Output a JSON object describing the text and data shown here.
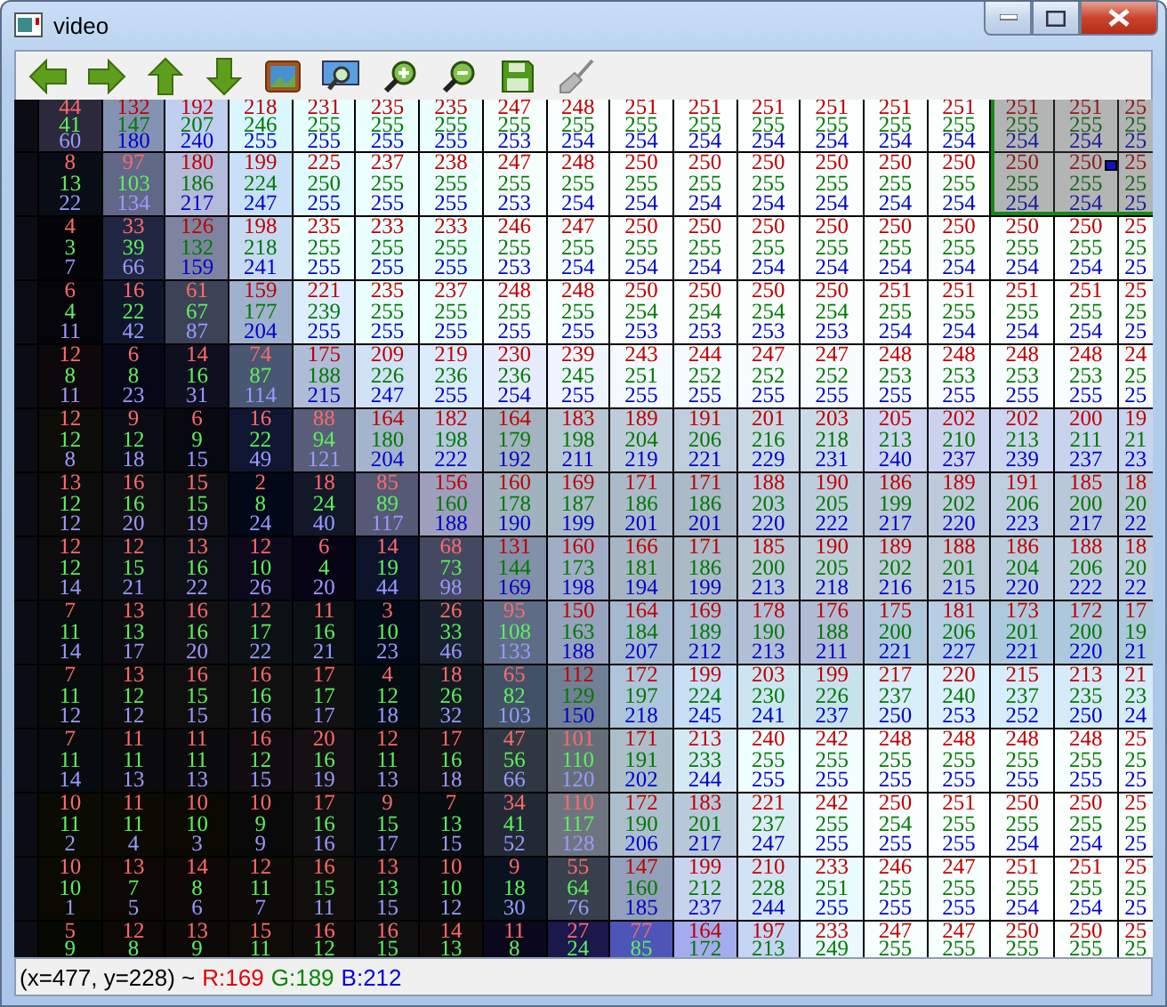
{
  "window": {
    "title": "video"
  },
  "selection": {
    "shown": true
  },
  "pixel_grid": {
    "rows": [
      {
        "red": [
          "44",
          "132",
          "192",
          "218",
          "231",
          "235",
          "235",
          "247",
          "248",
          "251",
          "251",
          "251",
          "251",
          "251",
          "251",
          "251",
          "251",
          "25"
        ],
        "green": [
          "41",
          "147",
          "207",
          "246",
          "255",
          "255",
          "255",
          "255",
          "255",
          "255",
          "255",
          "255",
          "255",
          "255",
          "255",
          "255",
          "255",
          "25"
        ],
        "blue": [
          "60",
          "180",
          "240",
          "255",
          "255",
          "255",
          "255",
          "253",
          "254",
          "254",
          "254",
          "254",
          "254",
          "254",
          "254",
          "254",
          "254",
          "25"
        ]
      },
      {
        "red": [
          "8",
          "97",
          "180",
          "199",
          "225",
          "237",
          "238",
          "247",
          "248",
          "250",
          "250",
          "250",
          "250",
          "250",
          "250",
          "250",
          "250",
          "25"
        ],
        "green": [
          "13",
          "103",
          "186",
          "224",
          "250",
          "255",
          "255",
          "255",
          "255",
          "255",
          "255",
          "255",
          "255",
          "255",
          "255",
          "255",
          "255",
          "25"
        ],
        "blue": [
          "22",
          "134",
          "217",
          "247",
          "255",
          "255",
          "255",
          "253",
          "254",
          "254",
          "254",
          "254",
          "254",
          "254",
          "254",
          "254",
          "254",
          "25"
        ]
      },
      {
        "red": [
          "4",
          "33",
          "126",
          "198",
          "235",
          "233",
          "233",
          "246",
          "247",
          "250",
          "250",
          "250",
          "250",
          "250",
          "250",
          "250",
          "250",
          "25"
        ],
        "green": [
          "3",
          "39",
          "132",
          "218",
          "255",
          "255",
          "255",
          "255",
          "255",
          "255",
          "255",
          "255",
          "255",
          "255",
          "255",
          "255",
          "255",
          "25"
        ],
        "blue": [
          "7",
          "66",
          "159",
          "241",
          "255",
          "255",
          "255",
          "253",
          "254",
          "254",
          "254",
          "254",
          "254",
          "254",
          "254",
          "254",
          "254",
          "25"
        ]
      },
      {
        "red": [
          "6",
          "16",
          "61",
          "159",
          "221",
          "235",
          "237",
          "248",
          "248",
          "250",
          "250",
          "250",
          "250",
          "251",
          "251",
          "251",
          "251",
          "25"
        ],
        "green": [
          "4",
          "22",
          "67",
          "177",
          "239",
          "255",
          "255",
          "255",
          "255",
          "254",
          "254",
          "254",
          "254",
          "255",
          "255",
          "255",
          "255",
          "25"
        ],
        "blue": [
          "11",
          "42",
          "87",
          "204",
          "255",
          "255",
          "255",
          "255",
          "255",
          "253",
          "253",
          "253",
          "253",
          "254",
          "254",
          "254",
          "254",
          "25"
        ]
      },
      {
        "red": [
          "12",
          "6",
          "14",
          "74",
          "175",
          "209",
          "219",
          "230",
          "239",
          "243",
          "244",
          "247",
          "247",
          "248",
          "248",
          "248",
          "248",
          "24"
        ],
        "green": [
          "8",
          "8",
          "16",
          "87",
          "188",
          "226",
          "236",
          "236",
          "245",
          "251",
          "252",
          "252",
          "252",
          "253",
          "253",
          "253",
          "253",
          "25"
        ],
        "blue": [
          "11",
          "23",
          "31",
          "114",
          "215",
          "247",
          "255",
          "254",
          "255",
          "255",
          "255",
          "255",
          "255",
          "255",
          "255",
          "255",
          "255",
          "25"
        ]
      },
      {
        "red": [
          "12",
          "9",
          "6",
          "16",
          "88",
          "164",
          "182",
          "164",
          "183",
          "189",
          "191",
          "201",
          "203",
          "205",
          "202",
          "202",
          "200",
          "19"
        ],
        "green": [
          "12",
          "12",
          "9",
          "22",
          "94",
          "180",
          "198",
          "179",
          "198",
          "204",
          "206",
          "216",
          "218",
          "213",
          "210",
          "213",
          "211",
          "21"
        ],
        "blue": [
          "8",
          "18",
          "15",
          "49",
          "121",
          "204",
          "222",
          "192",
          "211",
          "219",
          "221",
          "229",
          "231",
          "240",
          "237",
          "239",
          "237",
          "23"
        ]
      },
      {
        "red": [
          "13",
          "16",
          "15",
          "2",
          "18",
          "85",
          "156",
          "160",
          "169",
          "171",
          "171",
          "188",
          "190",
          "186",
          "189",
          "191",
          "185",
          "18"
        ],
        "green": [
          "12",
          "16",
          "15",
          "8",
          "24",
          "89",
          "160",
          "178",
          "187",
          "186",
          "186",
          "203",
          "205",
          "199",
          "202",
          "206",
          "200",
          "20"
        ],
        "blue": [
          "12",
          "20",
          "19",
          "24",
          "40",
          "117",
          "188",
          "190",
          "199",
          "201",
          "201",
          "220",
          "222",
          "217",
          "220",
          "223",
          "217",
          "22"
        ]
      },
      {
        "red": [
          "12",
          "12",
          "13",
          "12",
          "6",
          "14",
          "68",
          "131",
          "160",
          "166",
          "171",
          "185",
          "190",
          "189",
          "188",
          "186",
          "188",
          "18"
        ],
        "green": [
          "12",
          "15",
          "16",
          "10",
          "4",
          "19",
          "73",
          "144",
          "173",
          "181",
          "186",
          "200",
          "205",
          "202",
          "201",
          "204",
          "206",
          "20"
        ],
        "blue": [
          "14",
          "21",
          "22",
          "26",
          "20",
          "44",
          "98",
          "169",
          "198",
          "194",
          "199",
          "213",
          "218",
          "216",
          "215",
          "220",
          "222",
          "22"
        ]
      },
      {
        "red": [
          "7",
          "13",
          "16",
          "12",
          "11",
          "3",
          "26",
          "95",
          "150",
          "164",
          "169",
          "178",
          "176",
          "175",
          "181",
          "173",
          "172",
          "17"
        ],
        "green": [
          "11",
          "13",
          "16",
          "17",
          "16",
          "10",
          "33",
          "108",
          "163",
          "184",
          "189",
          "190",
          "188",
          "200",
          "206",
          "201",
          "200",
          "19"
        ],
        "blue": [
          "14",
          "17",
          "20",
          "22",
          "21",
          "23",
          "46",
          "133",
          "188",
          "207",
          "212",
          "213",
          "211",
          "221",
          "227",
          "221",
          "220",
          "21"
        ]
      },
      {
        "red": [
          "7",
          "13",
          "16",
          "16",
          "17",
          "4",
          "18",
          "65",
          "112",
          "172",
          "199",
          "203",
          "199",
          "217",
          "220",
          "215",
          "213",
          "21"
        ],
        "green": [
          "11",
          "12",
          "15",
          "16",
          "17",
          "12",
          "26",
          "82",
          "129",
          "197",
          "224",
          "230",
          "226",
          "237",
          "240",
          "237",
          "235",
          "23"
        ],
        "blue": [
          "12",
          "12",
          "15",
          "16",
          "17",
          "18",
          "32",
          "103",
          "150",
          "218",
          "245",
          "241",
          "237",
          "250",
          "253",
          "252",
          "250",
          "24"
        ]
      },
      {
        "red": [
          "7",
          "11",
          "11",
          "16",
          "20",
          "12",
          "17",
          "47",
          "101",
          "171",
          "213",
          "240",
          "242",
          "248",
          "248",
          "248",
          "248",
          "25"
        ],
        "green": [
          "11",
          "11",
          "11",
          "12",
          "16",
          "11",
          "16",
          "56",
          "110",
          "191",
          "233",
          "255",
          "255",
          "255",
          "255",
          "255",
          "255",
          "25"
        ],
        "blue": [
          "14",
          "13",
          "13",
          "15",
          "19",
          "13",
          "18",
          "66",
          "120",
          "202",
          "244",
          "255",
          "255",
          "255",
          "255",
          "255",
          "255",
          "25"
        ]
      },
      {
        "red": [
          "10",
          "11",
          "10",
          "10",
          "17",
          "9",
          "7",
          "34",
          "110",
          "172",
          "183",
          "221",
          "242",
          "250",
          "251",
          "250",
          "250",
          "25"
        ],
        "green": [
          "11",
          "11",
          "10",
          "9",
          "16",
          "15",
          "13",
          "41",
          "117",
          "190",
          "201",
          "237",
          "255",
          "254",
          "255",
          "255",
          "255",
          "25"
        ],
        "blue": [
          "2",
          "4",
          "3",
          "9",
          "16",
          "17",
          "15",
          "52",
          "128",
          "206",
          "217",
          "247",
          "255",
          "255",
          "255",
          "254",
          "254",
          "25"
        ]
      },
      {
        "red": [
          "10",
          "13",
          "14",
          "12",
          "16",
          "13",
          "10",
          "9",
          "55",
          "147",
          "199",
          "210",
          "233",
          "246",
          "247",
          "251",
          "251",
          "25"
        ],
        "green": [
          "10",
          "7",
          "8",
          "11",
          "15",
          "13",
          "10",
          "18",
          "64",
          "160",
          "212",
          "228",
          "251",
          "255",
          "255",
          "255",
          "255",
          "25"
        ],
        "blue": [
          "1",
          "5",
          "6",
          "7",
          "11",
          "15",
          "12",
          "30",
          "76",
          "185",
          "237",
          "244",
          "255",
          "255",
          "255",
          "254",
          "254",
          "25"
        ]
      },
      {
        "red": [
          "5",
          "12",
          "13",
          "15",
          "16",
          "16",
          "14",
          "11",
          "27",
          "77",
          "164",
          "197",
          "233",
          "247",
          "247",
          "250",
          "250",
          "25"
        ],
        "green": [
          "9",
          "8",
          "9",
          "11",
          "12",
          "15",
          "13",
          "8",
          "24",
          "85",
          "172",
          "213",
          "249",
          "255",
          "255",
          "255",
          "255",
          "25"
        ]
      }
    ]
  },
  "status_bar": {
    "position": "(x=477, y=228) ~",
    "red": "R:169",
    "green": "G:189",
    "blue": "B:212"
  }
}
